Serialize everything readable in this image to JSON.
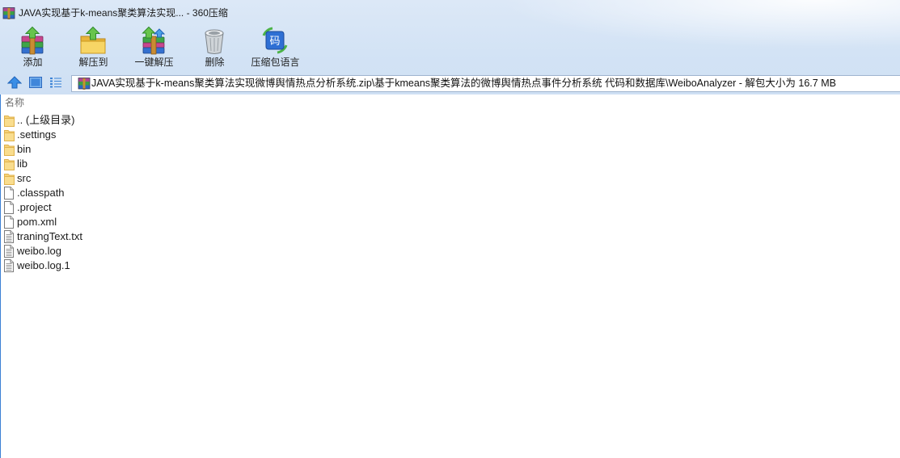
{
  "window": {
    "title": "JAVA实现基于k-means聚类算法实现... - 360压缩",
    "icon": "archive-icon"
  },
  "toolbar": {
    "add": {
      "label": "添加",
      "icon": "add-to-archive-icon"
    },
    "extract_to": {
      "label": "解压到",
      "icon": "extract-to-folder-icon"
    },
    "one_click_extract": {
      "label": "一键解压",
      "icon": "one-click-extract-icon"
    },
    "delete": {
      "label": "删除",
      "icon": "trash-icon"
    },
    "archive_language": {
      "label": "压缩包语言",
      "icon": "encoding-icon",
      "glyph": "码"
    }
  },
  "navigation": {
    "up_icon": "up-arrow-icon",
    "thumbnail_icon": "thumbnail-view-icon",
    "list_icon": "list-view-icon"
  },
  "path_bar": {
    "icon": "archive-icon",
    "text": "JAVA实现基于k-means聚类算法实现微博舆情热点分析系统.zip\\基于kmeans聚类算法的微博舆情热点事件分析系统 代码和数据库\\WeiboAnalyzer - 解包大小为 16.7 MB"
  },
  "file_list": {
    "columns": [
      {
        "label": "名称"
      }
    ],
    "items": [
      {
        "name": ".. (上级目录)",
        "icon": "folder-icon"
      },
      {
        "name": ".settings",
        "icon": "folder-icon"
      },
      {
        "name": "bin",
        "icon": "folder-icon"
      },
      {
        "name": "lib",
        "icon": "folder-icon"
      },
      {
        "name": "src",
        "icon": "folder-icon"
      },
      {
        "name": ".classpath",
        "icon": "file-icon"
      },
      {
        "name": ".project",
        "icon": "file-icon"
      },
      {
        "name": "pom.xml",
        "icon": "file-icon"
      },
      {
        "name": "traningText.txt",
        "icon": "text-file-icon"
      },
      {
        "name": "weibo.log",
        "icon": "text-file-icon"
      },
      {
        "name": "weibo.log.1",
        "icon": "text-file-icon"
      }
    ]
  },
  "colors": {
    "chrome_background": "#d3e3f5",
    "accent_blue": "#3c80d4",
    "folder_yellow": "#f6d37a",
    "header_text": "#6d6d6d",
    "text": "#1b1b1b"
  }
}
